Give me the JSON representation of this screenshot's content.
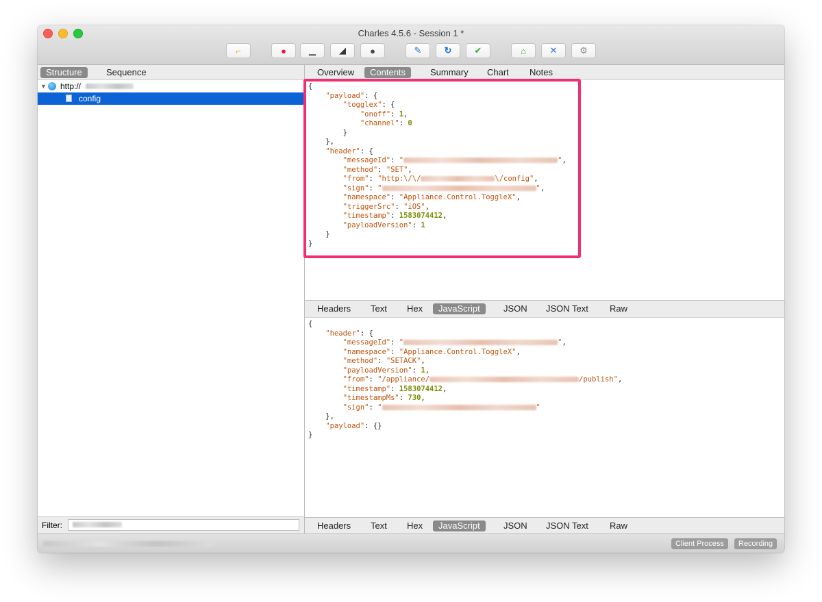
{
  "window": {
    "title": "Charles 4.5.6 - Session 1 *"
  },
  "colors": {
    "accent": "#0b63d6",
    "highlight": "#f0306e",
    "json_key": "#c0550e",
    "json_number": "#7a8f06"
  },
  "toolbar": {
    "buttons": [
      {
        "name": "broom-icon",
        "glyph": "⌐"
      },
      {
        "name": "record-icon",
        "glyph": "●"
      },
      {
        "name": "throttle-icon",
        "glyph": "▁"
      },
      {
        "name": "turtle-icon",
        "glyph": "◢"
      },
      {
        "name": "stop-icon",
        "glyph": "●"
      },
      {
        "name": "pen-icon",
        "glyph": "✎"
      },
      {
        "name": "refresh-icon",
        "glyph": "↻"
      },
      {
        "name": "check-icon",
        "glyph": "✔"
      },
      {
        "name": "basket-icon",
        "glyph": "⌂"
      },
      {
        "name": "tools-icon",
        "glyph": "✕"
      },
      {
        "name": "gear-icon",
        "glyph": "⚙"
      }
    ]
  },
  "sidebar": {
    "tabs": [
      "Structure",
      "Sequence"
    ],
    "host": "http://",
    "item": "config",
    "filter_label": "Filter:"
  },
  "main": {
    "top_tabs": [
      "Overview",
      "Contents",
      "Summary",
      "Chart",
      "Notes"
    ],
    "sub_tabs": [
      "Headers",
      "Text",
      "Hex",
      "JavaScript",
      "JSON",
      "JSON Text",
      "Raw"
    ]
  },
  "request_json": {
    "open": "{",
    "payload_key": "\"payload\"",
    "togglex_key": "\"togglex\"",
    "onoff_key": "\"onoff\"",
    "onoff_val": "1",
    "channel_key": "\"channel\"",
    "channel_val": "0",
    "header_key": "\"header\"",
    "messageId_key": "\"messageId\"",
    "method_key": "\"method\"",
    "method_val": "\"SET\"",
    "from_key": "\"from\"",
    "from_val_a": "\"http:\\/\\/",
    "from_val_b": "\\/config\"",
    "sign_key": "\"sign\"",
    "namespace_key": "\"namespace\"",
    "namespace_val": "\"Appliance.Control.ToggleX\"",
    "triggerSrc_key": "\"triggerSrc\"",
    "triggerSrc_val": "\"iOS\"",
    "timestamp_key": "\"timestamp\"",
    "timestamp_val": "1583074412",
    "payloadVersion_key": "\"payloadVersion\"",
    "payloadVersion_val": "1",
    "close": "}"
  },
  "response_json": {
    "header_key": "\"header\"",
    "messageId_key": "\"messageId\"",
    "namespace_key": "\"namespace\"",
    "namespace_val": "\"Appliance.Control.ToggleX\"",
    "method_key": "\"method\"",
    "method_val": "\"SETACK\"",
    "payloadVersion_key": "\"payloadVersion\"",
    "payloadVersion_val": "1",
    "from_key": "\"from\"",
    "from_val_a": "\"/appliance/",
    "from_val_b": "/publish\"",
    "timestamp_key": "\"timestamp\"",
    "timestamp_val": "1583074412",
    "timestampMs_key": "\"timestampMs\"",
    "timestampMs_val": "730",
    "sign_key": "\"sign\"",
    "payload_key": "\"payload\"",
    "payload_val": "{}"
  },
  "status": {
    "client_process": "Client Process",
    "recording": "Recording"
  }
}
